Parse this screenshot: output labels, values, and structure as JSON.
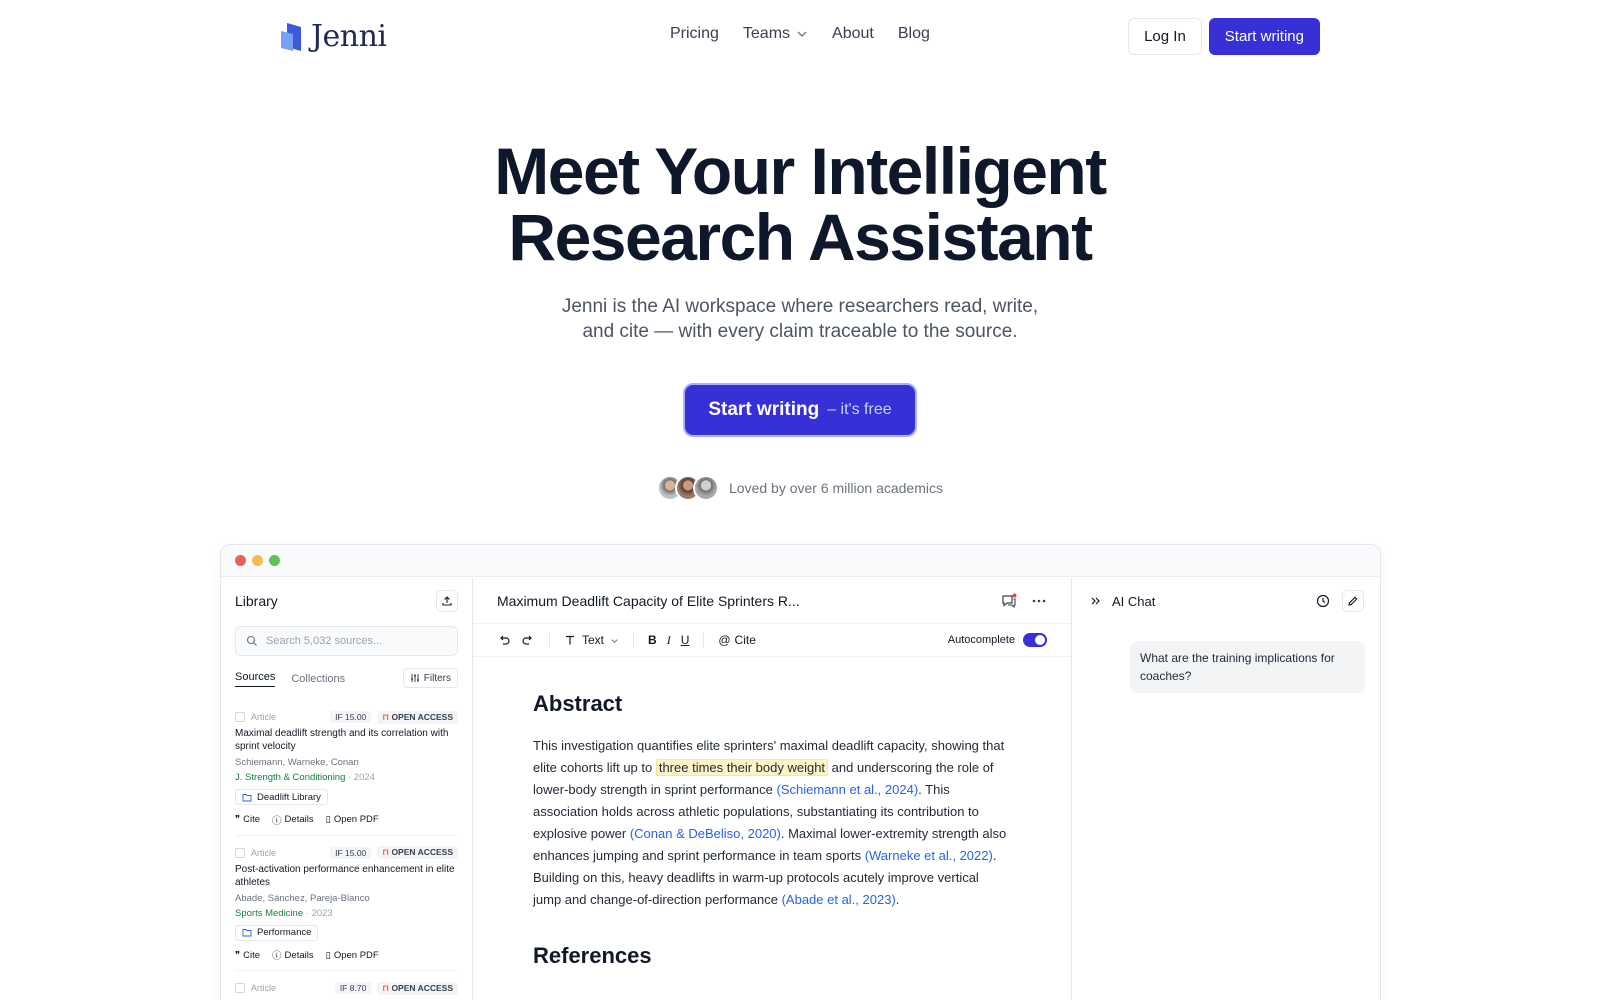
{
  "nav": {
    "logo_text": "Jenni",
    "links": [
      "Pricing",
      "Teams",
      "About",
      "Blog"
    ],
    "login_label": "Log In",
    "start_label": "Start writing"
  },
  "hero": {
    "title_line1": "Meet Your Intelligent",
    "title_line2": "Research Assistant",
    "subtitle_line1": "Jenni is the AI workspace where researchers read, write,",
    "subtitle_line2": "and cite — with every claim traceable to the source.",
    "cta_main": "Start writing",
    "cta_sub": "– it's free",
    "social_proof": "Loved by over 6 million academics"
  },
  "library": {
    "title": "Library",
    "search_placeholder": "Search 5,032 sources...",
    "tabs": [
      "Sources",
      "Collections"
    ],
    "filters_label": "Filters",
    "sources": [
      {
        "type": "Article",
        "if_label": "IF",
        "if_value": "15.00",
        "access": "OPEN ACCESS",
        "title": "Maximal deadlift strength and its correlation with sprint velocity",
        "authors": "Schiemann, Warneke, Conan",
        "journal": "J. Strength & Conditioning",
        "year": "· 2024",
        "folder": "Deadlift Library",
        "actions": [
          "Cite",
          "Details",
          "Open PDF"
        ]
      },
      {
        "type": "Article",
        "if_label": "IF",
        "if_value": "15.00",
        "access": "OPEN ACCESS",
        "title": "Post-activation performance enhancement in elite athletes",
        "authors": "Abade, Sánchez, Pareja-Blanco",
        "journal": "Sports Medicine",
        "year": "· 2023",
        "folder": "Performance",
        "actions": [
          "Cite",
          "Details",
          "Open PDF"
        ]
      },
      {
        "type": "Article",
        "if_label": "IF",
        "if_value": "8.70",
        "access": "OPEN ACCESS"
      }
    ]
  },
  "document": {
    "title": "Maximum Deadlift Capacity of Elite Sprinters R...",
    "toolbar": {
      "text_style": "Text",
      "bold": "B",
      "italic": "I",
      "underline": "U",
      "cite": "Cite",
      "autocomplete": "Autocomplete"
    },
    "abstract_heading": "Abstract",
    "abstract": {
      "p1": "This investigation quantifies elite sprinters' maximal deadlift capacity, showing that elite cohorts lift up to ",
      "highlight": "three times their body weight",
      "p2": " and underscoring the role of lower-body strength in sprint performance ",
      "cite1": "(Schiemann et al., 2024)",
      "p3": ". This association holds across athletic populations, substantiating its contribution to explosive power ",
      "cite2": "(Conan & DeBeliso, 2020)",
      "p4": ". Maximal lower-extremity strength also enhances jumping and sprint performance in team sports ",
      "cite3": "(Warneke et al., 2022)",
      "p5": ". Building on this, heavy deadlifts in warm-up protocols acutely improve vertical jump and change-of-direction performance ",
      "cite4": "(Abade et al., 2023)",
      "p6": "."
    },
    "references_heading": "References"
  },
  "chat": {
    "title": "AI Chat",
    "message": "What are the training implications for coaches?"
  },
  "colors": {
    "accent": "#3730d6",
    "citation": "#2563eb",
    "journal": "#15803d",
    "highlight": "#fef3c7"
  }
}
